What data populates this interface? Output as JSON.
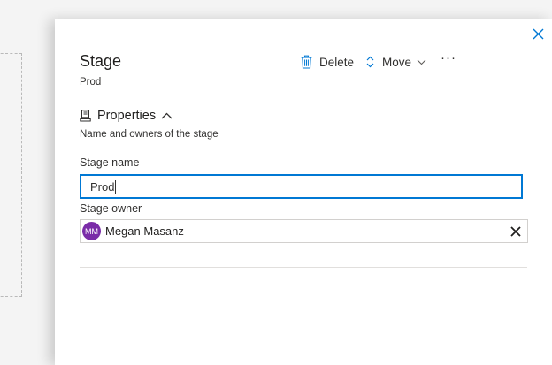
{
  "panel": {
    "title": "Stage",
    "subtitle": "Prod"
  },
  "commands": {
    "delete_label": "Delete",
    "move_label": "Move",
    "more_label": "···"
  },
  "properties": {
    "heading": "Properties",
    "description": "Name and owners of the stage"
  },
  "form": {
    "stage_name_label": "Stage name",
    "stage_name_value": "Prod",
    "stage_owner_label": "Stage owner",
    "owner": {
      "initials": "MM",
      "name": "Megan Masanz",
      "avatar_color": "#7a2ca8"
    }
  },
  "icons": {
    "close": "close-icon",
    "delete": "trash-icon",
    "move": "move-icon",
    "properties": "properties-icon",
    "collapse": "chevron-up-icon",
    "remove": "remove-x-icon"
  },
  "colors": {
    "accent": "#0078d4",
    "panel_bg": "#ffffff",
    "backdrop": "#f4f4f4"
  }
}
